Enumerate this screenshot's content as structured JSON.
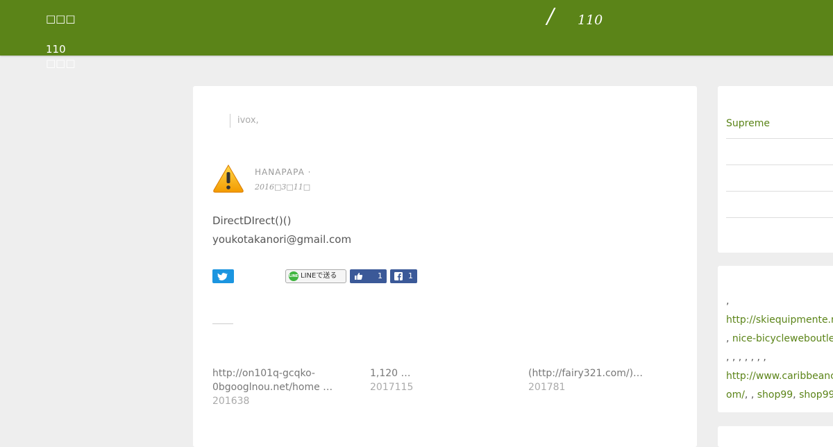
{
  "header": {
    "site_title": "□□□",
    "center_slash": "/",
    "center_number": "110"
  },
  "side_nav": {
    "line1": "110",
    "line2": "□□□"
  },
  "article": {
    "quote": "ivox,",
    "author": "HANAPAPA ·",
    "date": "2016□3□11□",
    "body_line1": "DirectDIrect()()",
    "body_line2": "youkotakanori@gmail.com",
    "share": {
      "line_label": "LINEで送る",
      "line_badge": "LINE",
      "fb_like_count": "1",
      "fb_share_count": "1"
    },
    "related": [
      {
        "title_l1": "http://on101q-gcqko-",
        "title_l2": "0bgooglnou.net/home …",
        "date": "201638"
      },
      {
        "title_l1": "1,120 …",
        "title_l2": "",
        "date": "2017115"
      },
      {
        "title_l1": "(http://fairy321.com/)…",
        "title_l2": "",
        "date": "201781"
      }
    ]
  },
  "sidebar": {
    "widget1_link": "Supreme",
    "widget2": {
      "line1": ",",
      "link1": "http://skiequipmente.n",
      "line3_prefix": ", ",
      "link2": "nice-bicycleweboutle",
      "line4": ", , , , , , ,",
      "link3": "http://www.caribbeanc",
      "link3b": "om/",
      "sep": ", , ",
      "link4": "shop99",
      "sep2": ", ",
      "link5": "shop99"
    }
  },
  "colors": {
    "brand": "#5b8418",
    "twitter": "#1b95e0",
    "facebook": "#3b5998"
  }
}
